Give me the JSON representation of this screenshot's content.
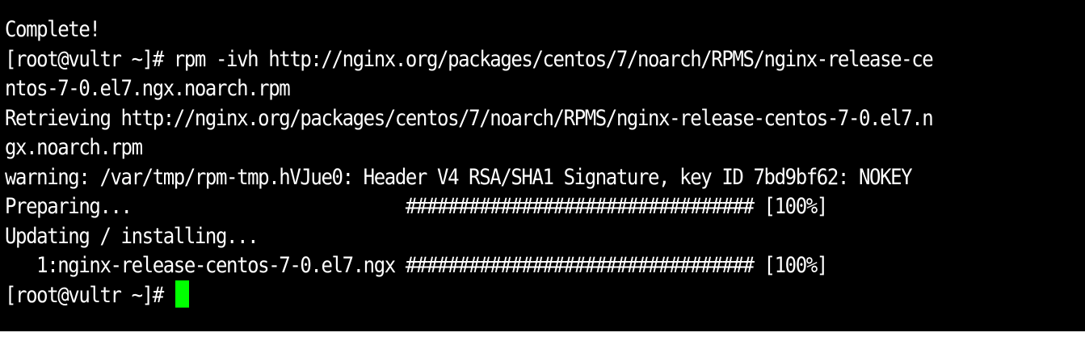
{
  "terminal": {
    "cursor_color": "#00ff00",
    "background": "#000000",
    "foreground": "#ffffff",
    "lines": [
      "Complete!",
      "[root@vultr ~]# rpm -ivh http://nginx.org/packages/centos/7/noarch/RPMS/nginx-release-ce",
      "ntos-7-0.el7.ngx.noarch.rpm",
      "Retrieving http://nginx.org/packages/centos/7/noarch/RPMS/nginx-release-centos-7-0.el7.n",
      "gx.noarch.rpm",
      "warning: /var/tmp/rpm-tmp.hVJue0: Header V4 RSA/SHA1 Signature, key ID 7bd9bf62: NOKEY",
      "Preparing...                          ################################# [100%]",
      "Updating / installing...",
      "   1:nginx-release-centos-7-0.el7.ngx ################################# [100%]"
    ],
    "prompt": "[root@vultr ~]# "
  }
}
